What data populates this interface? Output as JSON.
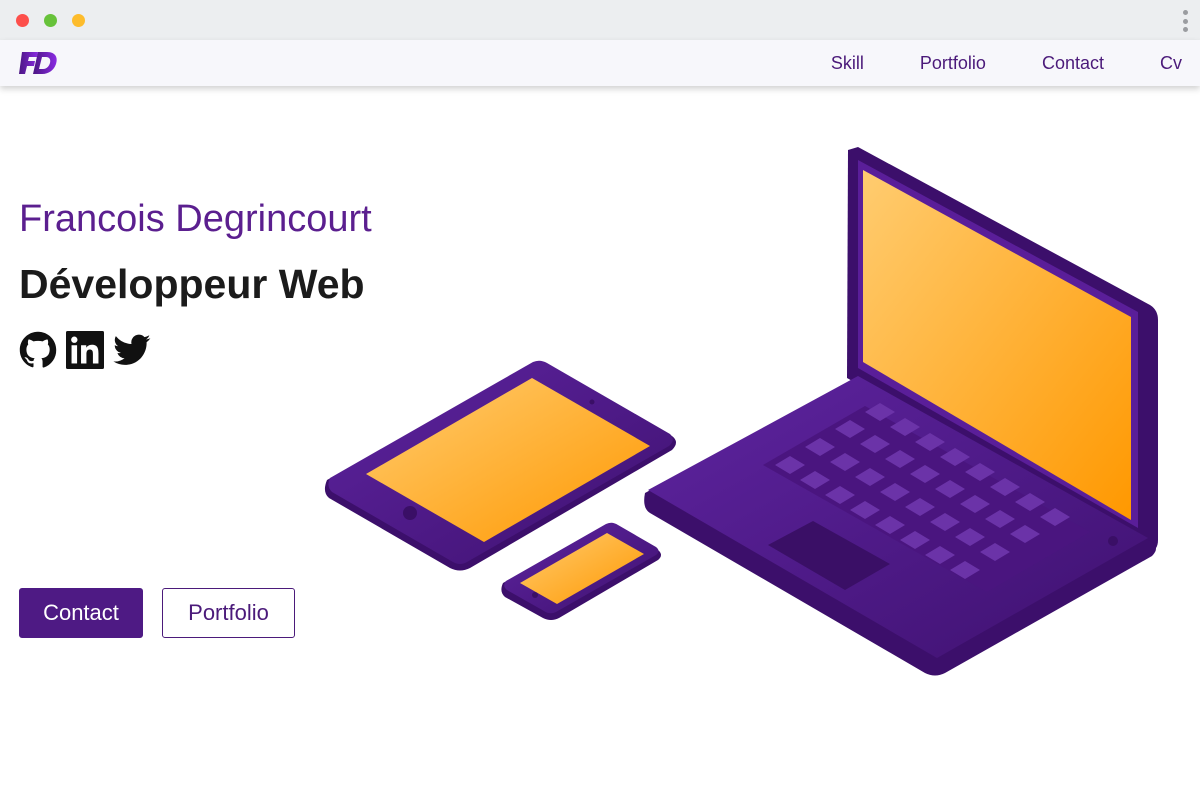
{
  "window": {
    "controls": [
      "close",
      "minimize",
      "maximize"
    ],
    "menu_icon": "kebab-menu-icon"
  },
  "nav": {
    "logo_text": "FD",
    "links": [
      "Skill",
      "Portfolio",
      "Contact",
      "Cv"
    ]
  },
  "hero": {
    "name": "Francois Degrincourt",
    "role": "Développeur Web",
    "socials": [
      "github-icon",
      "linkedin-icon",
      "twitter-icon"
    ],
    "buttons": {
      "primary": "Contact",
      "secondary": "Portfolio"
    }
  },
  "illustration": {
    "subject": "devices-illustration",
    "devices": [
      "laptop",
      "tablet",
      "phone"
    ]
  },
  "colors": {
    "accent": "#4e1a84",
    "name_color": "#5b1f8f",
    "screen_light": "#ffc86a",
    "screen_dark": "#ff9a00",
    "device_body": "#4b1683"
  }
}
